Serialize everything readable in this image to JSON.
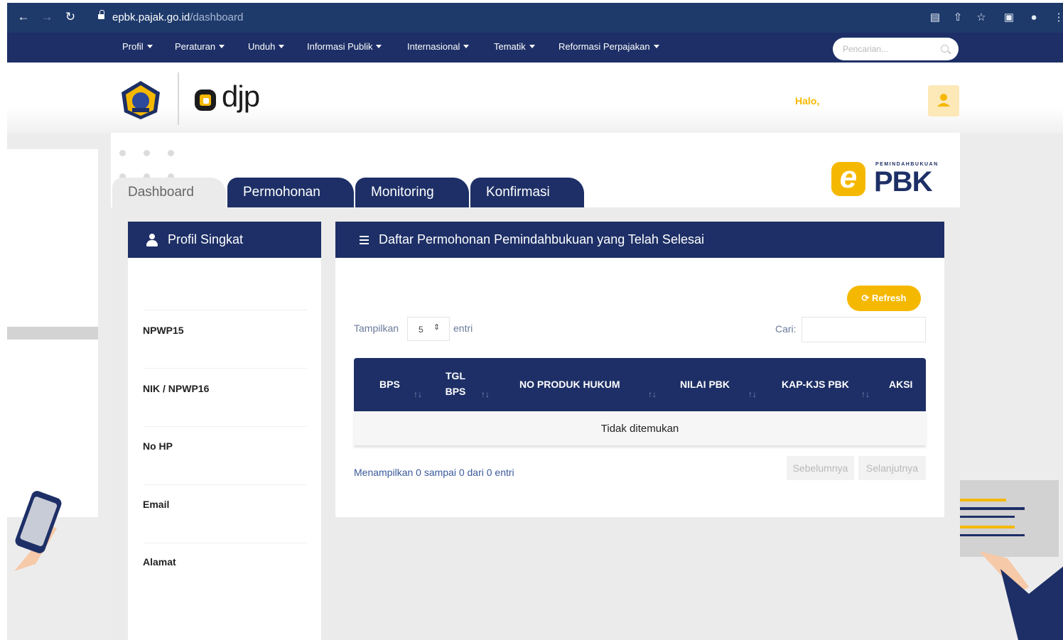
{
  "browser": {
    "url_host": "epbk.pajak.go.id",
    "url_path": "/dashboard"
  },
  "site_nav": {
    "items": [
      {
        "label": "Profil"
      },
      {
        "label": "Peraturan"
      },
      {
        "label": "Unduh"
      },
      {
        "label": "Informasi Publik"
      },
      {
        "label": "Internasional"
      },
      {
        "label": "Tematik"
      },
      {
        "label": "Reformasi Perpajakan"
      }
    ],
    "search_placeholder": "Pencarian..."
  },
  "header": {
    "logo_text": "djp",
    "greeting": "Halo,"
  },
  "tabs": [
    {
      "label": "Dashboard",
      "active": true
    },
    {
      "label": "Permohonan"
    },
    {
      "label": "Monitoring"
    },
    {
      "label": "Konfirmasi"
    }
  ],
  "brand": {
    "small_text": "PEMINDAHBUKUAN",
    "big_text": "PBK",
    "e_letter": "e"
  },
  "profile": {
    "title": "Profil Singkat",
    "fields": [
      "NPWP15",
      "NIK / NPWP16",
      "No HP",
      "Email",
      "Alamat"
    ]
  },
  "list": {
    "title": "Daftar Permohonan Pemindahbukuan yang Telah Selesai",
    "refresh_label": "Refresh",
    "show_label": "Tampilkan",
    "entries_label": "entri",
    "page_size": "5",
    "search_label": "Cari:",
    "columns": [
      "BPS",
      "TGL BPS",
      "NO PRODUK HUKUM",
      "NILAI PBK",
      "KAP-KJS PBK",
      "AKSI"
    ],
    "tgl_line1": "TGL",
    "tgl_line2": "BPS",
    "empty_message": "Tidak ditemukan",
    "info": "Menampilkan 0 sampai 0 dari 0 entri",
    "prev_label": "Sebelumnya",
    "next_label": "Selanjutnya"
  },
  "colors": {
    "navy": "#1d2f66",
    "browser_bar": "#1e3a6b",
    "accent_yellow": "#f5b800",
    "background": "#ebebeb"
  }
}
